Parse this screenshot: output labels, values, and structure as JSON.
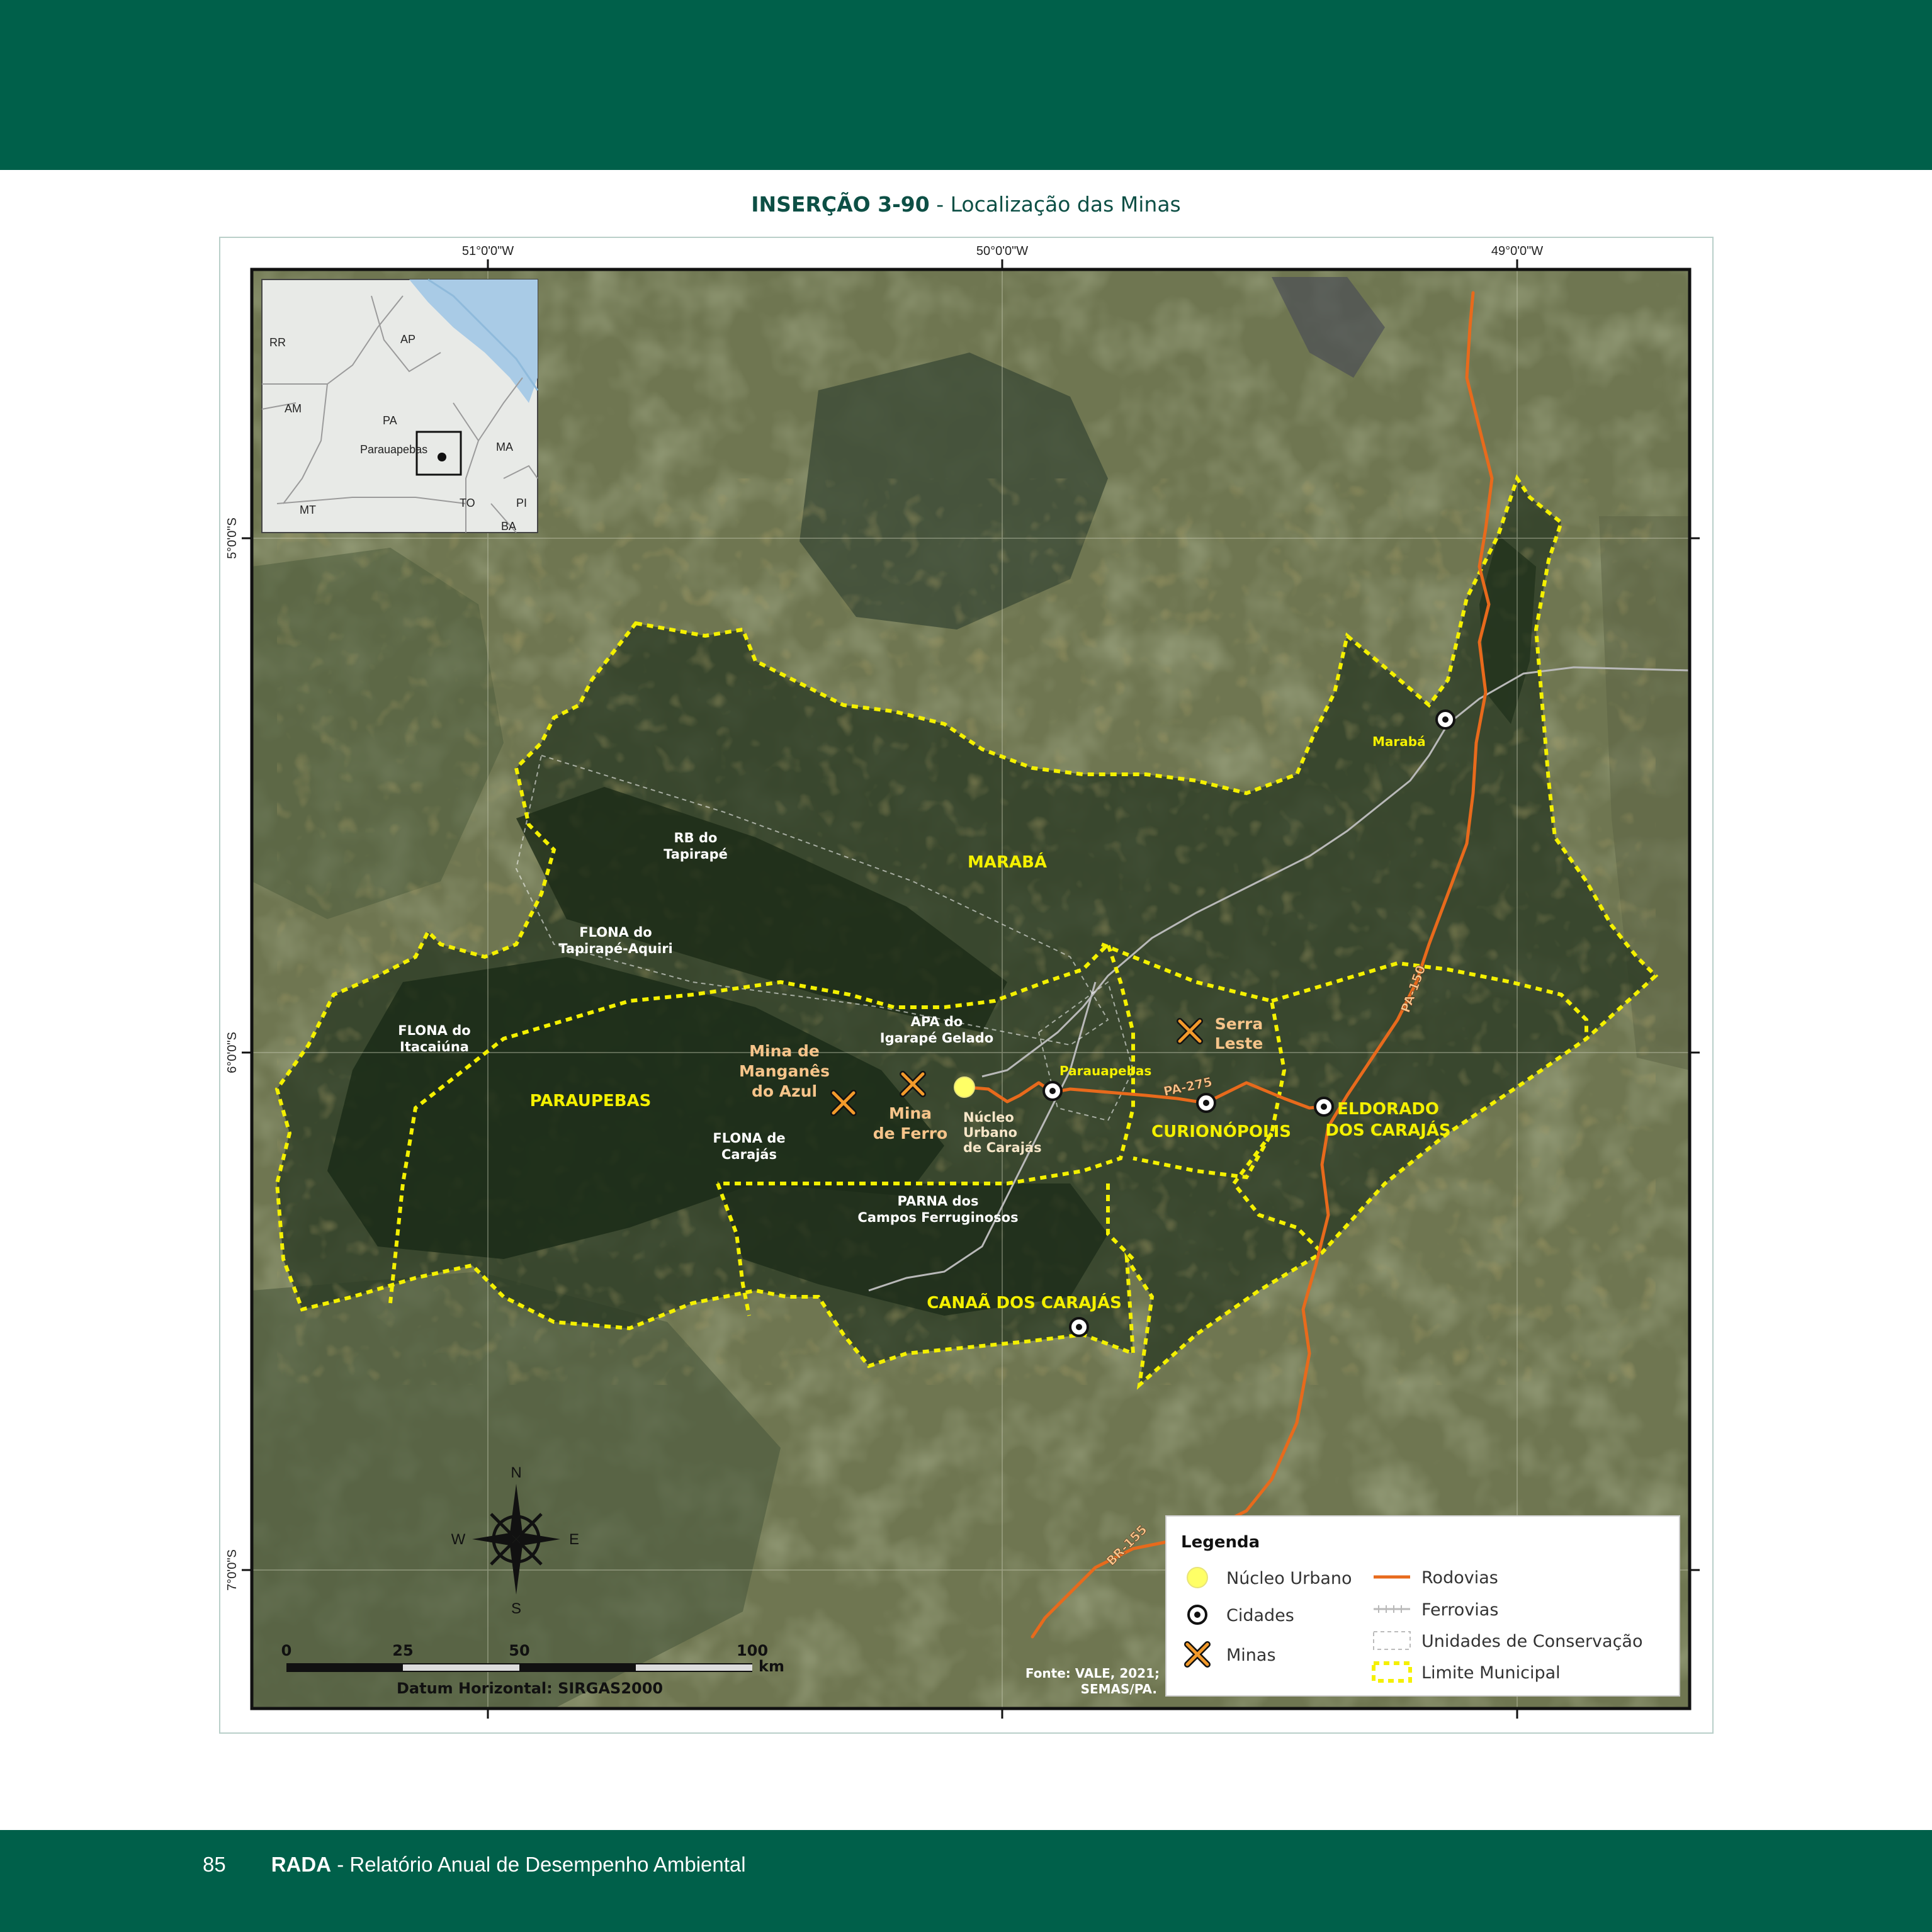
{
  "header": {
    "title_prefix": "INSERÇÃO 3-90",
    "title_sep": " - ",
    "title_text": "Localização das Minas"
  },
  "map": {
    "graticule_top": [
      "51°0'0\"W",
      "50°0'0\"W",
      "49°0'0\"W"
    ],
    "graticule_left": [
      "5°0'0\"S",
      "6°0'0\"S",
      "7°0'0\"S"
    ],
    "inset_labels": {
      "rr": "RR",
      "ap": "AP",
      "am": "AM",
      "pa": "PA",
      "parauapebas": "Parauapebas",
      "ma": "MA",
      "mt": "MT",
      "to": "TO",
      "pi": "PI",
      "ba": "BA"
    },
    "municipalities": {
      "maraba": "MARABÁ",
      "parauapebas": "PARAUPEBAS",
      "curionopolis": "CURIONÓPOLIS",
      "eldorado_1": "ELDORADO",
      "eldorado_2": "DOS CARAJÁS",
      "canaa": "CANAÃ DOS CARAJÁS"
    },
    "conservation_units": {
      "rb_1": "RB do",
      "rb_2": "Tapirapé",
      "flona_tap_1": "FLONA do",
      "flona_tap_2": "Tapirapé-Aquiri",
      "flona_ita_1": "FLONA do",
      "flona_ita_2": "Itacaiúna",
      "apa_1": "APA do",
      "apa_2": "Igarapé Gelado",
      "flona_car_1": "FLONA de",
      "flona_car_2": "Carajás",
      "parna_1": "PARNA dos",
      "parna_2": "Campos Ferruginosos"
    },
    "mines": {
      "manganes_1": "Mina de",
      "manganes_2": "Manganês",
      "manganes_3": "do Azul",
      "ferro_1": "Mina",
      "ferro_2": "de Ferro",
      "serra_1": "Serra",
      "serra_2": "Leste"
    },
    "urban": {
      "nucleo_1": "Núcleo",
      "nucleo_2": "Urbano",
      "nucleo_3": "de Carajás"
    },
    "cities": {
      "maraba": "Marabá",
      "parauapebas": "Parauapebas"
    },
    "roads": {
      "pa150": "PA-150",
      "pa275": "PA-275",
      "br155": "BR-155"
    },
    "compass": {
      "n": "N",
      "s": "S",
      "e": "E",
      "w": "W"
    },
    "scale": {
      "t0": "0",
      "t25": "25",
      "t50": "50",
      "t100": "100",
      "unit": "km",
      "datum": "Datum Horizontal: SIRGAS2000"
    },
    "source": {
      "line1": "Fonte: VALE, 2021;",
      "line2": "SEMAS/PA."
    },
    "legend": {
      "title": "Legenda",
      "nucleo": "Núcleo Urbano",
      "cidades": "Cidades",
      "minas": "Minas",
      "rodovias": "Rodovias",
      "ferrovias": "Ferrovias",
      "unidades": "Unidades de Conservação",
      "limite": "Limite Municipal"
    },
    "colors": {
      "boundary": "#f4f000",
      "road": "#e86a1c",
      "urban": "#ffff66",
      "label_yellow": "#f4f000",
      "label_mine": "#f6c48a"
    }
  },
  "footer": {
    "page_number": "85",
    "brand": "RADA",
    "subtitle": " - Relatório Anual de Desempenho Ambiental"
  }
}
